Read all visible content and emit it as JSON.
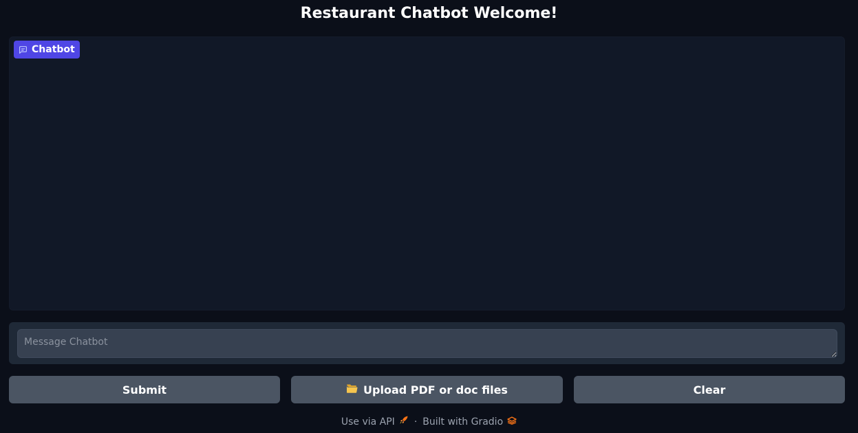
{
  "header": {
    "title": "Restaurant Chatbot Welcome!"
  },
  "chatbot": {
    "label": "Chatbot",
    "label_icon": "chat-bubble-icon",
    "accent_color": "#4f46e5"
  },
  "input": {
    "placeholder": "Message Chatbot",
    "value": ""
  },
  "buttons": {
    "submit_label": "Submit",
    "upload_label": "Upload PDF or doc files",
    "upload_icon": "folder-icon",
    "clear_label": "Clear"
  },
  "footer": {
    "api_link": "Use via API",
    "api_icon": "rocket-icon",
    "separator": "·",
    "built_with": "Built with Gradio",
    "gradio_icon": "gradio-logo-icon"
  }
}
